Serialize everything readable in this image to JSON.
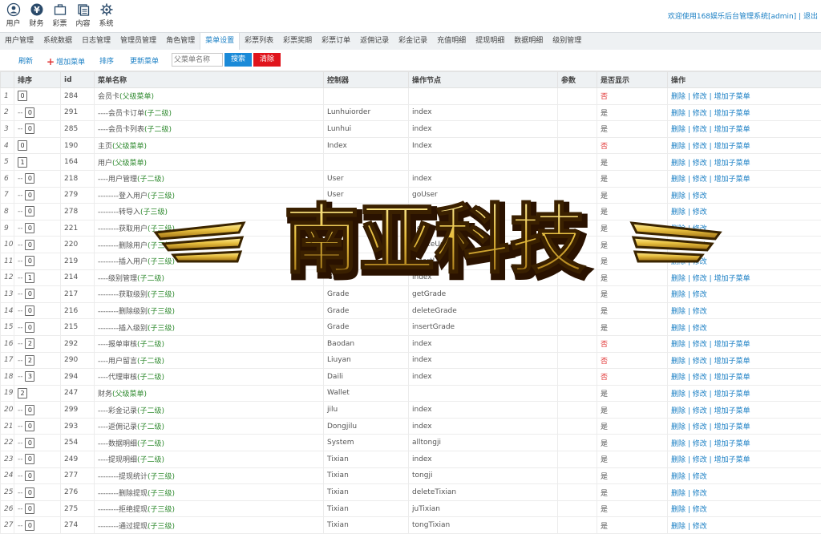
{
  "topnav": [
    {
      "label": "用户",
      "icon": "user-icon"
    },
    {
      "label": "财务",
      "icon": "yen-icon"
    },
    {
      "label": "彩票",
      "icon": "briefcase-icon"
    },
    {
      "label": "内容",
      "icon": "document-icon"
    },
    {
      "label": "系统",
      "icon": "gear-icon"
    }
  ],
  "header": {
    "welcome": "欢迎使用168娱乐后台管理系统[admin] | 退出"
  },
  "tabs": [
    "用户管理",
    "系统数据",
    "日志管理",
    "管理员管理",
    "角色管理",
    "菜单设置",
    "彩票列表",
    "彩票奖期",
    "彩票订单",
    "返佣记录",
    "彩金记录",
    "充值明细",
    "提现明细",
    "数据明细",
    "级别管理"
  ],
  "active_tab": 5,
  "toolbar": {
    "refresh": "刷新",
    "add_menu": "增加菜单",
    "sort": "排序",
    "update_menu": "更新菜单",
    "parent_placeholder": "父菜单名称",
    "search": "搜索",
    "clear": "清除"
  },
  "table": {
    "headers": [
      "",
      "排序",
      "id",
      "菜单名称",
      "控制器",
      "操作节点",
      "参数",
      "是否显示",
      "操作"
    ],
    "rows": [
      {
        "no": "1",
        "sort": "0",
        "indent": "",
        "id": "284",
        "name": "会员卡",
        "level": "(父级菜单)",
        "controller": "",
        "node": "",
        "param": "",
        "show": "否",
        "ops": [
          "删除",
          "修改",
          "增加子菜单"
        ]
      },
      {
        "no": "2",
        "sort": "0",
        "indent": "--",
        "id": "291",
        "name": "----会员卡订单",
        "level": "(子二级)",
        "controller": "Lunhuiorder",
        "node": "index",
        "param": "",
        "show": "是",
        "ops": [
          "删除",
          "修改",
          "增加子菜单"
        ]
      },
      {
        "no": "3",
        "sort": "0",
        "indent": "--",
        "id": "285",
        "name": "----会员卡列表",
        "level": "(子二级)",
        "controller": "Lunhui",
        "node": "index",
        "param": "",
        "show": "是",
        "ops": [
          "删除",
          "修改",
          "增加子菜单"
        ]
      },
      {
        "no": "4",
        "sort": "0",
        "indent": "",
        "id": "190",
        "name": "主页",
        "level": "(父级菜单)",
        "controller": "Index",
        "node": "Index",
        "param": "",
        "show": "否",
        "ops": [
          "删除",
          "修改",
          "增加子菜单"
        ]
      },
      {
        "no": "5",
        "sort": "1",
        "indent": "",
        "id": "164",
        "name": "用户",
        "level": "(父级菜单)",
        "controller": "",
        "node": "",
        "param": "",
        "show": "是",
        "ops": [
          "删除",
          "修改",
          "增加子菜单"
        ]
      },
      {
        "no": "6",
        "sort": "0",
        "indent": "--",
        "id": "218",
        "name": "----用户管理",
        "level": "(子二级)",
        "controller": "User",
        "node": "index",
        "param": "",
        "show": "是",
        "ops": [
          "删除",
          "修改",
          "增加子菜单"
        ]
      },
      {
        "no": "7",
        "sort": "0",
        "indent": "--",
        "id": "279",
        "name": "--------登入用户",
        "level": "(子三级)",
        "controller": "User",
        "node": "goUser",
        "param": "",
        "show": "是",
        "ops": [
          "删除",
          "修改"
        ]
      },
      {
        "no": "8",
        "sort": "0",
        "indent": "--",
        "id": "278",
        "name": "--------转导入",
        "level": "(子三级)",
        "controller": "User",
        "node": "...User",
        "param": "",
        "show": "是",
        "ops": [
          "删除",
          "修改"
        ]
      },
      {
        "no": "9",
        "sort": "0",
        "indent": "--",
        "id": "221",
        "name": "--------获取用户",
        "level": "(子三级)",
        "controller": "User",
        "node": "getUser",
        "param": "",
        "show": "是",
        "ops": [
          "删除",
          "修改"
        ]
      },
      {
        "no": "10",
        "sort": "0",
        "indent": "--",
        "id": "220",
        "name": "--------删除用户",
        "level": "(子三级)",
        "controller": "User",
        "node": "deleteUser",
        "param": "",
        "show": "是",
        "ops": [
          "删除",
          "修改"
        ]
      },
      {
        "no": "11",
        "sort": "0",
        "indent": "--",
        "id": "219",
        "name": "--------插入用户",
        "level": "(子三级)",
        "controller": "User",
        "node": "insertUser",
        "param": "",
        "show": "是",
        "ops": [
          "删除",
          "修改"
        ]
      },
      {
        "no": "12",
        "sort": "1",
        "indent": "--",
        "id": "214",
        "name": "----级别管理",
        "level": "(子二级)",
        "controller": "Grade",
        "node": "index",
        "param": "",
        "show": "是",
        "ops": [
          "删除",
          "修改",
          "增加子菜单"
        ]
      },
      {
        "no": "13",
        "sort": "0",
        "indent": "--",
        "id": "217",
        "name": "--------获取级别",
        "level": "(子三级)",
        "controller": "Grade",
        "node": "getGrade",
        "param": "",
        "show": "是",
        "ops": [
          "删除",
          "修改"
        ]
      },
      {
        "no": "14",
        "sort": "0",
        "indent": "--",
        "id": "216",
        "name": "--------删除级别",
        "level": "(子三级)",
        "controller": "Grade",
        "node": "deleteGrade",
        "param": "",
        "show": "是",
        "ops": [
          "删除",
          "修改"
        ]
      },
      {
        "no": "15",
        "sort": "0",
        "indent": "--",
        "id": "215",
        "name": "--------插入级别",
        "level": "(子三级)",
        "controller": "Grade",
        "node": "insertGrade",
        "param": "",
        "show": "是",
        "ops": [
          "删除",
          "修改"
        ]
      },
      {
        "no": "16",
        "sort": "2",
        "indent": "--",
        "id": "292",
        "name": "----报单审核",
        "level": "(子二级)",
        "controller": "Baodan",
        "node": "index",
        "param": "",
        "show": "否",
        "ops": [
          "删除",
          "修改",
          "增加子菜单"
        ]
      },
      {
        "no": "17",
        "sort": "2",
        "indent": "--",
        "id": "290",
        "name": "----用户留言",
        "level": "(子二级)",
        "controller": "Liuyan",
        "node": "index",
        "param": "",
        "show": "否",
        "ops": [
          "删除",
          "修改",
          "增加子菜单"
        ]
      },
      {
        "no": "18",
        "sort": "3",
        "indent": "--",
        "id": "294",
        "name": "----代理审核",
        "level": "(子二级)",
        "controller": "Daili",
        "node": "index",
        "param": "",
        "show": "否",
        "ops": [
          "删除",
          "修改",
          "增加子菜单"
        ]
      },
      {
        "no": "19",
        "sort": "2",
        "indent": "",
        "id": "247",
        "name": "财务",
        "level": "(父级菜单)",
        "controller": "Wallet",
        "node": "",
        "param": "",
        "show": "是",
        "ops": [
          "删除",
          "修改",
          "增加子菜单"
        ]
      },
      {
        "no": "20",
        "sort": "0",
        "indent": "--",
        "id": "299",
        "name": "----彩金记录",
        "level": "(子二级)",
        "controller": "jilu",
        "node": "index",
        "param": "",
        "show": "是",
        "ops": [
          "删除",
          "修改",
          "增加子菜单"
        ]
      },
      {
        "no": "21",
        "sort": "0",
        "indent": "--",
        "id": "293",
        "name": "----返佣记录",
        "level": "(子二级)",
        "controller": "Dongjilu",
        "node": "index",
        "param": "",
        "show": "是",
        "ops": [
          "删除",
          "修改",
          "增加子菜单"
        ]
      },
      {
        "no": "22",
        "sort": "0",
        "indent": "--",
        "id": "254",
        "name": "----数据明细",
        "level": "(子二级)",
        "controller": "System",
        "node": "alltongji",
        "param": "",
        "show": "是",
        "ops": [
          "删除",
          "修改",
          "增加子菜单"
        ]
      },
      {
        "no": "23",
        "sort": "0",
        "indent": "--",
        "id": "249",
        "name": "----提现明细",
        "level": "(子二级)",
        "controller": "Tixian",
        "node": "index",
        "param": "",
        "show": "是",
        "ops": [
          "删除",
          "修改",
          "增加子菜单"
        ]
      },
      {
        "no": "24",
        "sort": "0",
        "indent": "--",
        "id": "277",
        "name": "--------提现统计",
        "level": "(子三级)",
        "controller": "Tixian",
        "node": "tongji",
        "param": "",
        "show": "是",
        "ops": [
          "删除",
          "修改"
        ]
      },
      {
        "no": "25",
        "sort": "0",
        "indent": "--",
        "id": "276",
        "name": "--------删除提现",
        "level": "(子三级)",
        "controller": "Tixian",
        "node": "deleteTixian",
        "param": "",
        "show": "是",
        "ops": [
          "删除",
          "修改"
        ]
      },
      {
        "no": "26",
        "sort": "0",
        "indent": "--",
        "id": "275",
        "name": "--------拒绝提现",
        "level": "(子三级)",
        "controller": "Tixian",
        "node": "juTixian",
        "param": "",
        "show": "是",
        "ops": [
          "删除",
          "修改"
        ]
      },
      {
        "no": "27",
        "sort": "0",
        "indent": "--",
        "id": "274",
        "name": "--------通过提现",
        "level": "(子三级)",
        "controller": "Tixian",
        "node": "tongTixian",
        "param": "",
        "show": "是",
        "ops": [
          "删除",
          "修改"
        ]
      }
    ]
  },
  "watermark": {
    "text": "南亚科技"
  },
  "colors": {
    "link": "#1a7fc4",
    "child_level": "#2f8a2f",
    "no_flag": "#e03333",
    "search_btn": "#1a8ad8",
    "clear_btn": "#e0141c",
    "watermark_gold": "#e8c040"
  }
}
